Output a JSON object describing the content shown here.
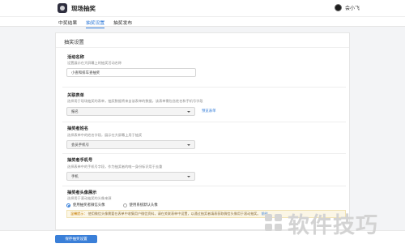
{
  "header": {
    "app_title": "现场抽奖",
    "user_name": "会小飞"
  },
  "tabs": [
    {
      "label": "中奖结果"
    },
    {
      "label": "抽奖设置"
    },
    {
      "label": "抽奖发布"
    }
  ],
  "active_tab": "抽奖设置",
  "panel": {
    "title": "抽奖设置",
    "activity_name": {
      "label": "活动名称",
      "desc": "设置展示在大屏幕上的抽奖活动名称",
      "value": "小查和排车查抽奖"
    },
    "linked_form": {
      "label": "关联表单",
      "desc": "选择用于现场抽奖的表单，抽奖数据将来自该表单的数据，该表单需包含姓名和手机号字段",
      "value": "报名",
      "preview_link": "预览表单"
    },
    "winner_name": {
      "label": "抽奖者姓名",
      "desc": "选择表单中的姓名字段，展示在大屏幕上用于抽奖",
      "value": "会员手机号"
    },
    "winner_phone": {
      "label": "抽奖者手机号",
      "desc": "选择表单中的手机号字段，作为抽奖者的唯一身份标识用于去重",
      "value": "手机"
    },
    "avatar_display": {
      "label": "抽奖者头像展示",
      "desc": "选择用于滚动抽奖的头像来源",
      "options": [
        {
          "label": "使用抽奖者微信头像",
          "checked": true
        },
        {
          "label": "使用系统默认头像",
          "checked": false
        }
      ],
      "tip_head": "温馨提示：",
      "tip_body": "使用微信头像需要在表单中收集用户微信资料，请在关联表单中设置，以通过抽奖者填表获取微信头像用于滚动抽奖。",
      "tip_link": "前往"
    }
  },
  "footer": {
    "save_label": "保存抽奖设置"
  },
  "watermark": {
    "text": "软件技巧"
  }
}
